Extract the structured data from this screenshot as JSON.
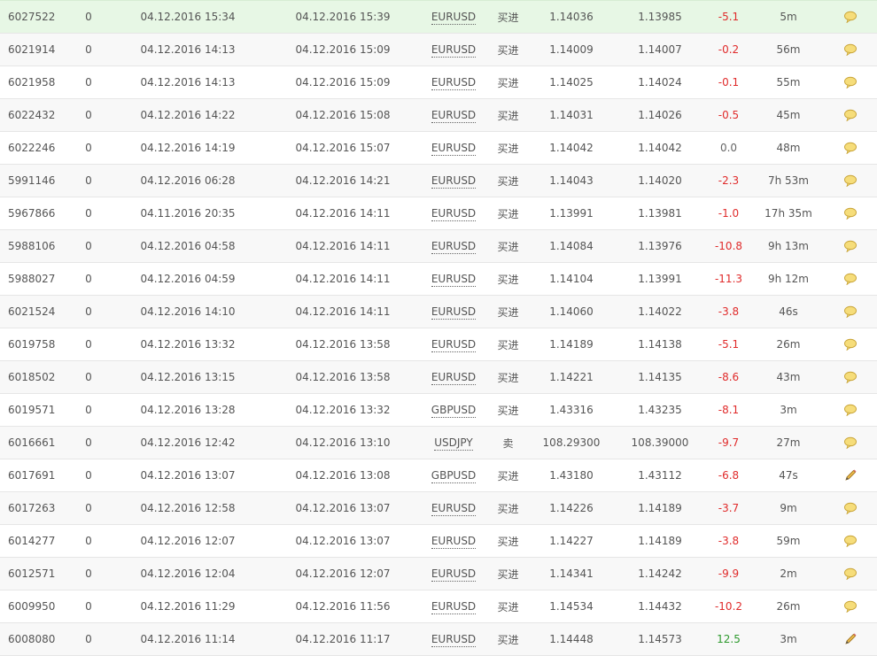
{
  "colors": {
    "negative": "#e02b2b",
    "positive": "#2e9a2e",
    "highlight_row": "#e7f7e5"
  },
  "trades": [
    {
      "ticket": "6027522",
      "magic": "0",
      "open_time": "04.12.2016 15:34",
      "close_time": "04.12.2016 15:39",
      "symbol": "EURUSD",
      "type": "买进",
      "open_price": "1.14036",
      "close_price": "1.13985",
      "profit": "-5.1",
      "duration": "5m",
      "icon": "comment-bubble-icon"
    },
    {
      "ticket": "6021914",
      "magic": "0",
      "open_time": "04.12.2016 14:13",
      "close_time": "04.12.2016 15:09",
      "symbol": "EURUSD",
      "type": "买进",
      "open_price": "1.14009",
      "close_price": "1.14007",
      "profit": "-0.2",
      "duration": "56m",
      "icon": "comment-bubble-icon"
    },
    {
      "ticket": "6021958",
      "magic": "0",
      "open_time": "04.12.2016 14:13",
      "close_time": "04.12.2016 15:09",
      "symbol": "EURUSD",
      "type": "买进",
      "open_price": "1.14025",
      "close_price": "1.14024",
      "profit": "-0.1",
      "duration": "55m",
      "icon": "comment-bubble-icon"
    },
    {
      "ticket": "6022432",
      "magic": "0",
      "open_time": "04.12.2016 14:22",
      "close_time": "04.12.2016 15:08",
      "symbol": "EURUSD",
      "type": "买进",
      "open_price": "1.14031",
      "close_price": "1.14026",
      "profit": "-0.5",
      "duration": "45m",
      "icon": "comment-bubble-icon"
    },
    {
      "ticket": "6022246",
      "magic": "0",
      "open_time": "04.12.2016 14:19",
      "close_time": "04.12.2016 15:07",
      "symbol": "EURUSD",
      "type": "买进",
      "open_price": "1.14042",
      "close_price": "1.14042",
      "profit": "0.0",
      "duration": "48m",
      "icon": "comment-bubble-icon"
    },
    {
      "ticket": "5991146",
      "magic": "0",
      "open_time": "04.12.2016 06:28",
      "close_time": "04.12.2016 14:21",
      "symbol": "EURUSD",
      "type": "买进",
      "open_price": "1.14043",
      "close_price": "1.14020",
      "profit": "-2.3",
      "duration": "7h 53m",
      "icon": "comment-bubble-icon"
    },
    {
      "ticket": "5967866",
      "magic": "0",
      "open_time": "04.11.2016 20:35",
      "close_time": "04.12.2016 14:11",
      "symbol": "EURUSD",
      "type": "买进",
      "open_price": "1.13991",
      "close_price": "1.13981",
      "profit": "-1.0",
      "duration": "17h 35m",
      "icon": "comment-bubble-icon"
    },
    {
      "ticket": "5988106",
      "magic": "0",
      "open_time": "04.12.2016 04:58",
      "close_time": "04.12.2016 14:11",
      "symbol": "EURUSD",
      "type": "买进",
      "open_price": "1.14084",
      "close_price": "1.13976",
      "profit": "-10.8",
      "duration": "9h 13m",
      "icon": "comment-bubble-icon"
    },
    {
      "ticket": "5988027",
      "magic": "0",
      "open_time": "04.12.2016 04:59",
      "close_time": "04.12.2016 14:11",
      "symbol": "EURUSD",
      "type": "买进",
      "open_price": "1.14104",
      "close_price": "1.13991",
      "profit": "-11.3",
      "duration": "9h 12m",
      "icon": "comment-bubble-icon"
    },
    {
      "ticket": "6021524",
      "magic": "0",
      "open_time": "04.12.2016 14:10",
      "close_time": "04.12.2016 14:11",
      "symbol": "EURUSD",
      "type": "买进",
      "open_price": "1.14060",
      "close_price": "1.14022",
      "profit": "-3.8",
      "duration": "46s",
      "icon": "comment-bubble-icon"
    },
    {
      "ticket": "6019758",
      "magic": "0",
      "open_time": "04.12.2016 13:32",
      "close_time": "04.12.2016 13:58",
      "symbol": "EURUSD",
      "type": "买进",
      "open_price": "1.14189",
      "close_price": "1.14138",
      "profit": "-5.1",
      "duration": "26m",
      "icon": "comment-bubble-icon"
    },
    {
      "ticket": "6018502",
      "magic": "0",
      "open_time": "04.12.2016 13:15",
      "close_time": "04.12.2016 13:58",
      "symbol": "EURUSD",
      "type": "买进",
      "open_price": "1.14221",
      "close_price": "1.14135",
      "profit": "-8.6",
      "duration": "43m",
      "icon": "comment-bubble-icon"
    },
    {
      "ticket": "6019571",
      "magic": "0",
      "open_time": "04.12.2016 13:28",
      "close_time": "04.12.2016 13:32",
      "symbol": "GBPUSD",
      "type": "买进",
      "open_price": "1.43316",
      "close_price": "1.43235",
      "profit": "-8.1",
      "duration": "3m",
      "icon": "comment-bubble-icon"
    },
    {
      "ticket": "6016661",
      "magic": "0",
      "open_time": "04.12.2016 12:42",
      "close_time": "04.12.2016 13:10",
      "symbol": "USDJPY",
      "type": "卖",
      "open_price": "108.29300",
      "close_price": "108.39000",
      "profit": "-9.7",
      "duration": "27m",
      "icon": "comment-bubble-icon"
    },
    {
      "ticket": "6017691",
      "magic": "0",
      "open_time": "04.12.2016 13:07",
      "close_time": "04.12.2016 13:08",
      "symbol": "GBPUSD",
      "type": "买进",
      "open_price": "1.43180",
      "close_price": "1.43112",
      "profit": "-6.8",
      "duration": "47s",
      "icon": "pencil-icon"
    },
    {
      "ticket": "6017263",
      "magic": "0",
      "open_time": "04.12.2016 12:58",
      "close_time": "04.12.2016 13:07",
      "symbol": "EURUSD",
      "type": "买进",
      "open_price": "1.14226",
      "close_price": "1.14189",
      "profit": "-3.7",
      "duration": "9m",
      "icon": "comment-bubble-icon"
    },
    {
      "ticket": "6014277",
      "magic": "0",
      "open_time": "04.12.2016 12:07",
      "close_time": "04.12.2016 13:07",
      "symbol": "EURUSD",
      "type": "买进",
      "open_price": "1.14227",
      "close_price": "1.14189",
      "profit": "-3.8",
      "duration": "59m",
      "icon": "comment-bubble-icon"
    },
    {
      "ticket": "6012571",
      "magic": "0",
      "open_time": "04.12.2016 12:04",
      "close_time": "04.12.2016 12:07",
      "symbol": "EURUSD",
      "type": "买进",
      "open_price": "1.14341",
      "close_price": "1.14242",
      "profit": "-9.9",
      "duration": "2m",
      "icon": "comment-bubble-icon"
    },
    {
      "ticket": "6009950",
      "magic": "0",
      "open_time": "04.12.2016 11:29",
      "close_time": "04.12.2016 11:56",
      "symbol": "EURUSD",
      "type": "买进",
      "open_price": "1.14534",
      "close_price": "1.14432",
      "profit": "-10.2",
      "duration": "26m",
      "icon": "comment-bubble-icon"
    },
    {
      "ticket": "6008080",
      "magic": "0",
      "open_time": "04.12.2016 11:14",
      "close_time": "04.12.2016 11:17",
      "symbol": "EURUSD",
      "type": "买进",
      "open_price": "1.14448",
      "close_price": "1.14573",
      "profit": "12.5",
      "duration": "3m",
      "icon": "pencil-icon"
    }
  ]
}
